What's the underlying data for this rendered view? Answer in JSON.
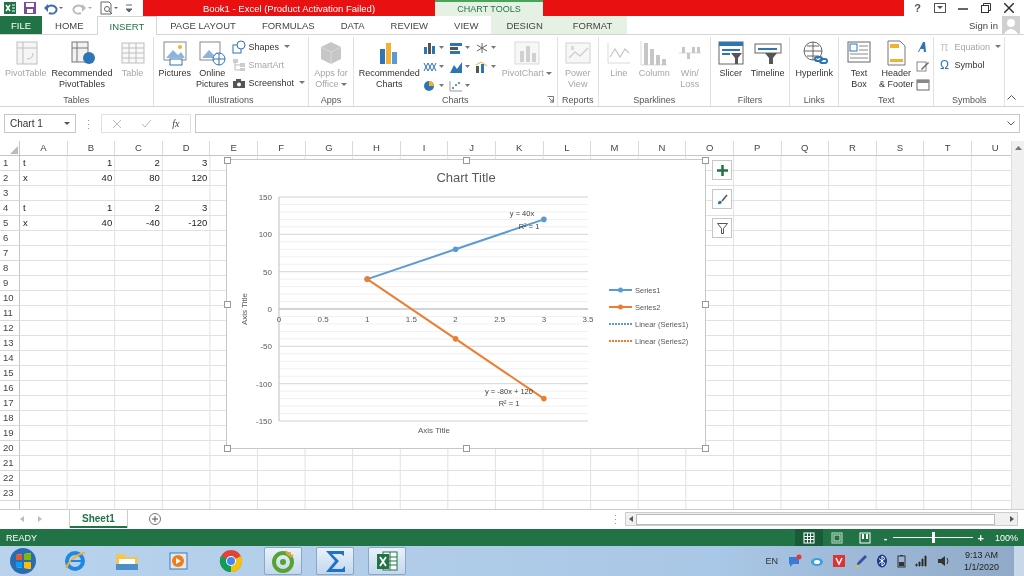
{
  "title_bar": {
    "title": "Book1 -  Excel (Product Activation Failed)",
    "context_label": "CHART TOOLS",
    "help": "?"
  },
  "tabs": [
    {
      "label": "FILE",
      "kind": "file",
      "selected": false
    },
    {
      "label": "HOME",
      "kind": "normal",
      "selected": false
    },
    {
      "label": "INSERT",
      "kind": "normal",
      "selected": true
    },
    {
      "label": "PAGE LAYOUT",
      "kind": "normal",
      "selected": false
    },
    {
      "label": "FORMULAS",
      "kind": "normal",
      "selected": false
    },
    {
      "label": "DATA",
      "kind": "normal",
      "selected": false
    },
    {
      "label": "REVIEW",
      "kind": "normal",
      "selected": false
    },
    {
      "label": "VIEW",
      "kind": "normal",
      "selected": false
    },
    {
      "label": "DESIGN",
      "kind": "contextual",
      "selected": false
    },
    {
      "label": "FORMAT",
      "kind": "contextual",
      "selected": false
    }
  ],
  "sign_in": "Sign in",
  "ribbon": {
    "groups": [
      {
        "label": "Tables",
        "launcher": false,
        "items": [
          {
            "kind": "large",
            "label": "PivotTable",
            "disabled": true,
            "dropdown": false
          },
          {
            "kind": "large",
            "label": "Recommended\nPivotTables",
            "disabled": false,
            "dropdown": false
          },
          {
            "kind": "large",
            "label": "Table",
            "disabled": true,
            "dropdown": false
          }
        ]
      },
      {
        "label": "Illustrations",
        "launcher": false,
        "items": [
          {
            "kind": "large",
            "label": "Pictures",
            "disabled": false,
            "dropdown": false
          },
          {
            "kind": "large",
            "label": "Online\nPictures",
            "disabled": false,
            "dropdown": false
          },
          {
            "kind": "stack",
            "items": [
              {
                "label": "Shapes",
                "disabled": false,
                "dropdown": true
              },
              {
                "label": "SmartArt",
                "disabled": true,
                "dropdown": false
              },
              {
                "label": "Screenshot",
                "disabled": false,
                "dropdown": true
              }
            ]
          }
        ]
      },
      {
        "label": "Apps",
        "launcher": false,
        "items": [
          {
            "kind": "large",
            "label": "Apps for\nOffice",
            "disabled": true,
            "dropdown": true
          }
        ]
      },
      {
        "label": "Charts",
        "launcher": true,
        "items": [
          {
            "kind": "large",
            "label": "Recommended\nCharts",
            "disabled": false,
            "dropdown": false
          },
          {
            "kind": "gallery"
          },
          {
            "kind": "large",
            "label": "PivotChart",
            "disabled": true,
            "dropdown": true
          }
        ]
      },
      {
        "label": "Reports",
        "launcher": false,
        "items": [
          {
            "kind": "large",
            "label": "Power\nView",
            "disabled": true,
            "dropdown": false
          }
        ]
      },
      {
        "label": "Sparklines",
        "launcher": false,
        "items": [
          {
            "kind": "large",
            "label": "Line",
            "disabled": true,
            "dropdown": false
          },
          {
            "kind": "large",
            "label": "Column",
            "disabled": true,
            "dropdown": false
          },
          {
            "kind": "large",
            "label": "Win/\nLoss",
            "disabled": true,
            "dropdown": false
          }
        ]
      },
      {
        "label": "Filters",
        "launcher": false,
        "items": [
          {
            "kind": "large",
            "label": "Slicer",
            "disabled": false,
            "dropdown": false
          },
          {
            "kind": "large",
            "label": "Timeline",
            "disabled": false,
            "dropdown": false
          }
        ]
      },
      {
        "label": "Links",
        "launcher": false,
        "items": [
          {
            "kind": "large",
            "label": "Hyperlink",
            "disabled": false,
            "dropdown": false
          }
        ]
      },
      {
        "label": "Text",
        "launcher": false,
        "items": [
          {
            "kind": "large",
            "label": "Text\nBox",
            "disabled": false,
            "dropdown": false
          },
          {
            "kind": "large",
            "label": "Header\n& Footer",
            "disabled": false,
            "dropdown": false
          },
          {
            "kind": "icons"
          }
        ]
      },
      {
        "label": "Symbols",
        "launcher": false,
        "items": [
          {
            "kind": "stack",
            "items": [
              {
                "glyph": "π",
                "label": "Equation",
                "disabled": true,
                "dropdown": true
              },
              {
                "glyph": "Ω",
                "label": "Symbol",
                "disabled": false,
                "dropdown": false
              }
            ]
          }
        ]
      }
    ]
  },
  "formula_bar": {
    "name_box": "Chart 1",
    "function_label": "fx"
  },
  "sheet": {
    "columns": [
      "A",
      "B",
      "C",
      "D",
      "E",
      "F",
      "G",
      "H",
      "I",
      "J",
      "K",
      "L",
      "M",
      "N",
      "O",
      "P",
      "Q",
      "R",
      "S",
      "T",
      "U"
    ],
    "rows": [
      {
        "label": "1",
        "cells": [
          "t",
          "1",
          "2",
          "3"
        ]
      },
      {
        "label": "2",
        "cells": [
          "x",
          "40",
          "80",
          "120"
        ]
      },
      {
        "label": "3"
      },
      {
        "label": "4",
        "cells": [
          "t",
          "1",
          "2",
          "3"
        ]
      },
      {
        "label": "5",
        "cells": [
          "x",
          "40",
          "-40",
          "-120"
        ]
      },
      {
        "label": "6"
      },
      {
        "label": "7"
      },
      {
        "label": "8"
      },
      {
        "label": "9"
      },
      {
        "label": "10"
      },
      {
        "label": "11"
      },
      {
        "label": "12"
      },
      {
        "label": "13"
      },
      {
        "label": "14"
      },
      {
        "label": "15"
      },
      {
        "label": "16"
      },
      {
        "label": "17"
      },
      {
        "label": "18"
      },
      {
        "label": "19"
      },
      {
        "label": "20"
      },
      {
        "label": "21"
      },
      {
        "label": "22"
      },
      {
        "label": "23"
      }
    ]
  },
  "chart": {
    "chart_data": {
      "type": "line",
      "title": "Chart Title",
      "xlabel": "Axis Title",
      "ylabel": "Axis Title",
      "x": [
        1,
        2,
        3
      ],
      "series": [
        {
          "name": "Series1",
          "color": "#5b9bd5",
          "values": [
            40,
            80,
            120
          ]
        },
        {
          "name": "Series2",
          "color": "#ed7d31",
          "values": [
            40,
            -40,
            -120
          ]
        }
      ],
      "xlim": [
        0,
        3.5
      ],
      "ylim": [
        -150,
        150
      ],
      "xticks": [
        0,
        0.5,
        1,
        1.5,
        2,
        2.5,
        3,
        3.5
      ],
      "yticks": [
        -150,
        -100,
        -50,
        0,
        50,
        100,
        150
      ],
      "grid": true,
      "legend": "right",
      "annotations": [
        "y = 40x",
        "R² = 1",
        "y = -80x + 120",
        "R² = 1"
      ]
    },
    "trendlines": [
      {
        "name": "Linear (Series1)",
        "color": "#5b9bd5"
      },
      {
        "name": "Linear (Series2)",
        "color": "#ed7d31"
      }
    ]
  },
  "sheet_tabs": [
    {
      "label": "Sheet1",
      "selected": true
    }
  ],
  "status_bar": {
    "text": "READY",
    "views": [
      {
        "selected": true
      },
      {
        "selected": false
      },
      {
        "selected": false
      }
    ],
    "zoom_out": "-",
    "zoom_slider": {
      "level": 0.5
    },
    "zoom_in": "+",
    "zoom": "100%"
  },
  "taskbar": {
    "apps": [
      {
        "running": false
      },
      {
        "running": false
      },
      {
        "running": false
      },
      {
        "running": false
      },
      {
        "running": false
      },
      {
        "running": true
      },
      {
        "running": true
      },
      {
        "running": true
      }
    ],
    "language": "EN",
    "time": "9:13 AM",
    "date": "1/1/2020"
  }
}
